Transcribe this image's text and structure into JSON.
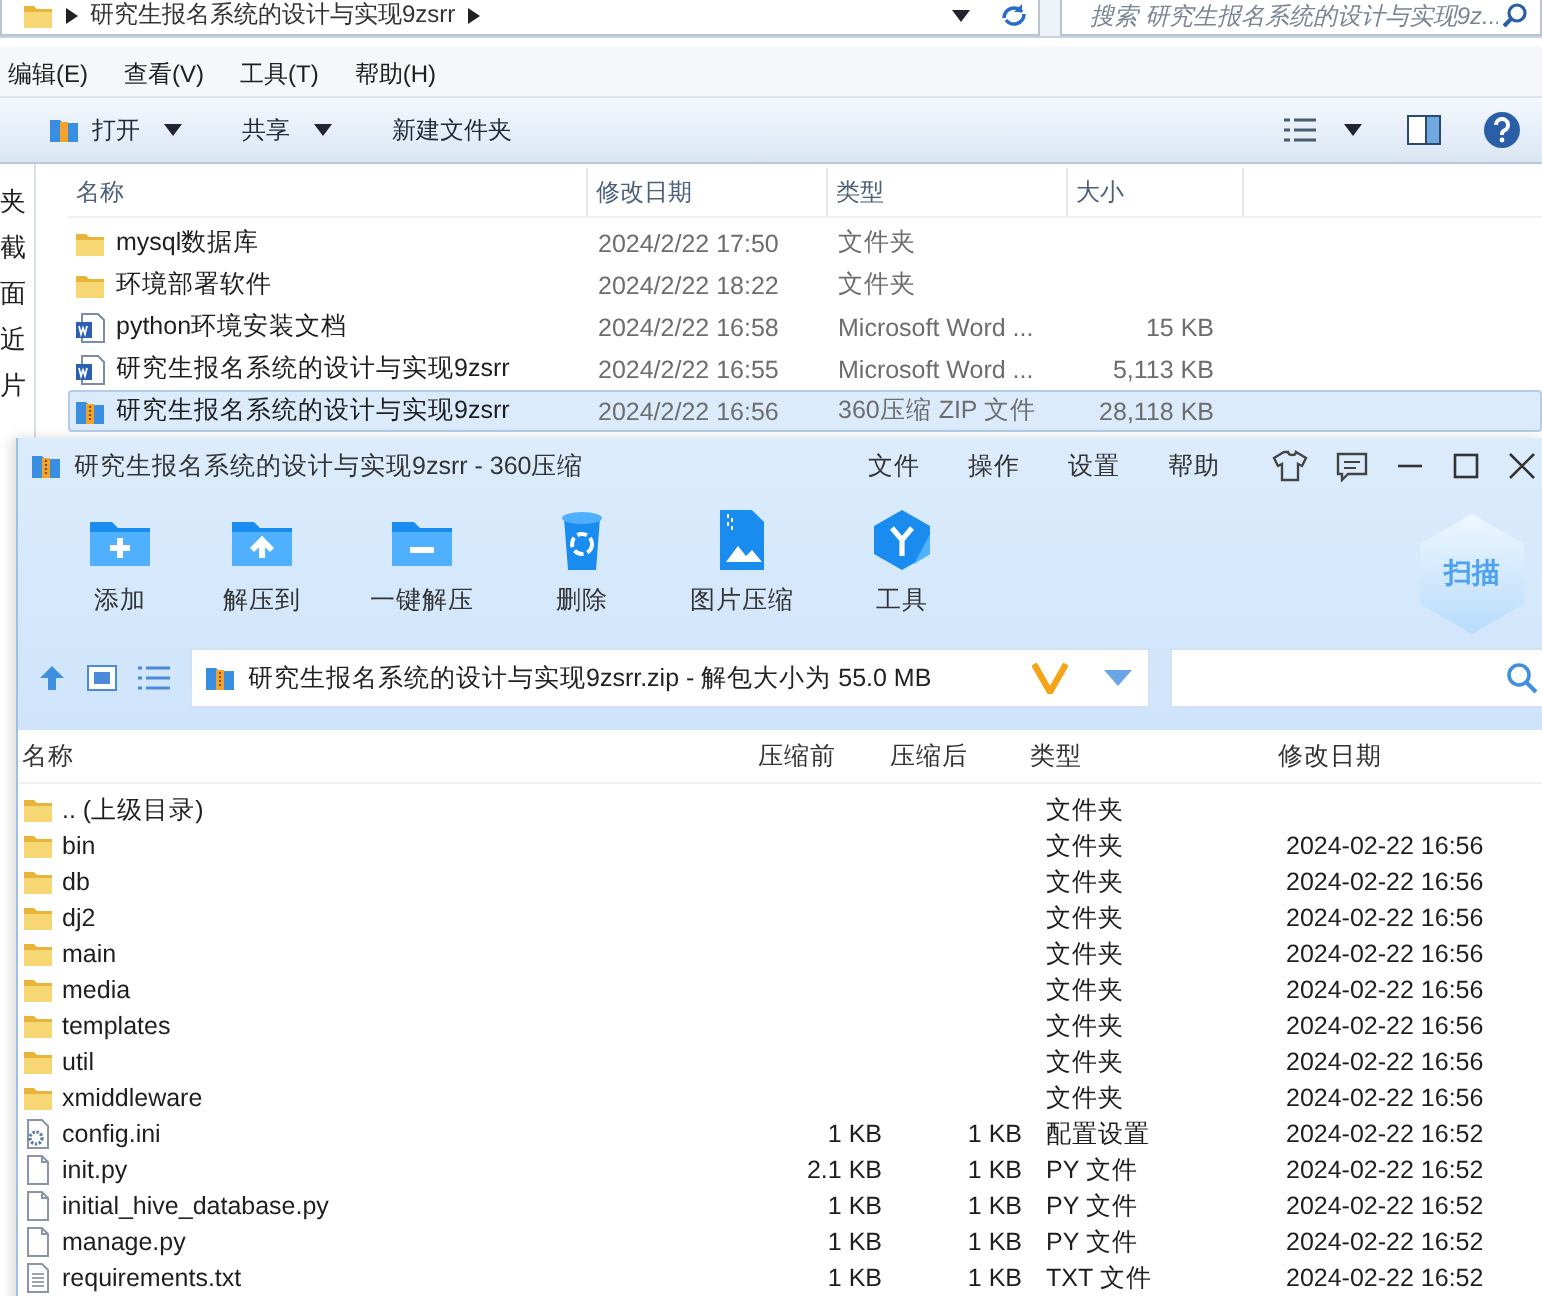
{
  "explorer": {
    "address": {
      "path": "研究生报名系统的设计与实现9zsrr"
    },
    "search": {
      "placeholder": "搜索 研究生报名系统的设计与实现9z..."
    },
    "menu": [
      "编辑(E)",
      "查看(V)",
      "工具(T)",
      "帮助(H)"
    ],
    "toolbar": [
      {
        "label": "打开",
        "kind": "open",
        "menu": true
      },
      {
        "label": "共享",
        "kind": "text",
        "menu": true
      },
      {
        "label": "新建文件夹",
        "kind": "text",
        "menu": false
      }
    ],
    "nav_items": [
      "夹",
      "截",
      "面",
      "近",
      "片"
    ],
    "columns": [
      "名称",
      "修改日期",
      "类型",
      "大小"
    ],
    "rows": [
      {
        "name": "mysql数据库",
        "modified": "2024/2/22 17:50",
        "type": "文件夹",
        "size": "",
        "kind": "folder",
        "selected": false
      },
      {
        "name": "环境部署软件",
        "modified": "2024/2/22 18:22",
        "type": "文件夹",
        "size": "",
        "kind": "folder",
        "selected": false
      },
      {
        "name": "python环境安装文档",
        "modified": "2024/2/22 16:58",
        "type": "Microsoft Word ...",
        "size": "15 KB",
        "kind": "word",
        "selected": false
      },
      {
        "name": "研究生报名系统的设计与实现9zsrr",
        "modified": "2024/2/22 16:55",
        "type": "Microsoft Word ...",
        "size": "5,113 KB",
        "kind": "word",
        "selected": false
      },
      {
        "name": "研究生报名系统的设计与实现9zsrr",
        "modified": "2024/2/22 16:56",
        "type": "360压缩 ZIP 文件",
        "size": "28,118 KB",
        "kind": "zip",
        "selected": true
      }
    ]
  },
  "archiver": {
    "title": "研究生报名系统的设计与实现9zsrr - 360压缩",
    "menu": [
      "文件",
      "操作",
      "设置",
      "帮助"
    ],
    "toolbar": [
      {
        "label": "添加",
        "kind": "add"
      },
      {
        "label": "解压到",
        "kind": "extract"
      },
      {
        "label": "一键解压",
        "kind": "quick"
      },
      {
        "label": "删除",
        "kind": "delete"
      },
      {
        "label": "图片压缩",
        "kind": "image"
      },
      {
        "label": "工具",
        "kind": "tools"
      }
    ],
    "scan_button": "扫描",
    "path": "研究生报名系统的设计与实现9zsrr.zip - 解包大小为 55.0 MB",
    "columns": [
      "名称",
      "压缩前",
      "压缩后",
      "类型",
      "修改日期"
    ],
    "rows": [
      {
        "name": ".. (上级目录)",
        "before": "",
        "after": "",
        "type": "文件夹",
        "modified": "",
        "kind": "folder"
      },
      {
        "name": "bin",
        "before": "",
        "after": "",
        "type": "文件夹",
        "modified": "2024-02-22 16:56",
        "kind": "folder"
      },
      {
        "name": "db",
        "before": "",
        "after": "",
        "type": "文件夹",
        "modified": "2024-02-22 16:56",
        "kind": "folder"
      },
      {
        "name": "dj2",
        "before": "",
        "after": "",
        "type": "文件夹",
        "modified": "2024-02-22 16:56",
        "kind": "folder"
      },
      {
        "name": "main",
        "before": "",
        "after": "",
        "type": "文件夹",
        "modified": "2024-02-22 16:56",
        "kind": "folder"
      },
      {
        "name": "media",
        "before": "",
        "after": "",
        "type": "文件夹",
        "modified": "2024-02-22 16:56",
        "kind": "folder"
      },
      {
        "name": "templates",
        "before": "",
        "after": "",
        "type": "文件夹",
        "modified": "2024-02-22 16:56",
        "kind": "folder"
      },
      {
        "name": "util",
        "before": "",
        "after": "",
        "type": "文件夹",
        "modified": "2024-02-22 16:56",
        "kind": "folder"
      },
      {
        "name": "xmiddleware",
        "before": "",
        "after": "",
        "type": "文件夹",
        "modified": "2024-02-22 16:56",
        "kind": "folder"
      },
      {
        "name": "config.ini",
        "before": "1 KB",
        "after": "1 KB",
        "type": "配置设置",
        "modified": "2024-02-22 16:52",
        "kind": "config"
      },
      {
        "name": "init.py",
        "before": "2.1 KB",
        "after": "1 KB",
        "type": "PY 文件",
        "modified": "2024-02-22 16:52",
        "kind": "file"
      },
      {
        "name": "initial_hive_database.py",
        "before": "1 KB",
        "after": "1 KB",
        "type": "PY 文件",
        "modified": "2024-02-22 16:52",
        "kind": "file"
      },
      {
        "name": "manage.py",
        "before": "1 KB",
        "after": "1 KB",
        "type": "PY 文件",
        "modified": "2024-02-22 16:52",
        "kind": "file"
      },
      {
        "name": "requirements.txt",
        "before": "1 KB",
        "after": "1 KB",
        "type": "TXT 文件",
        "modified": "2024-02-22 16:52",
        "kind": "text"
      }
    ]
  }
}
